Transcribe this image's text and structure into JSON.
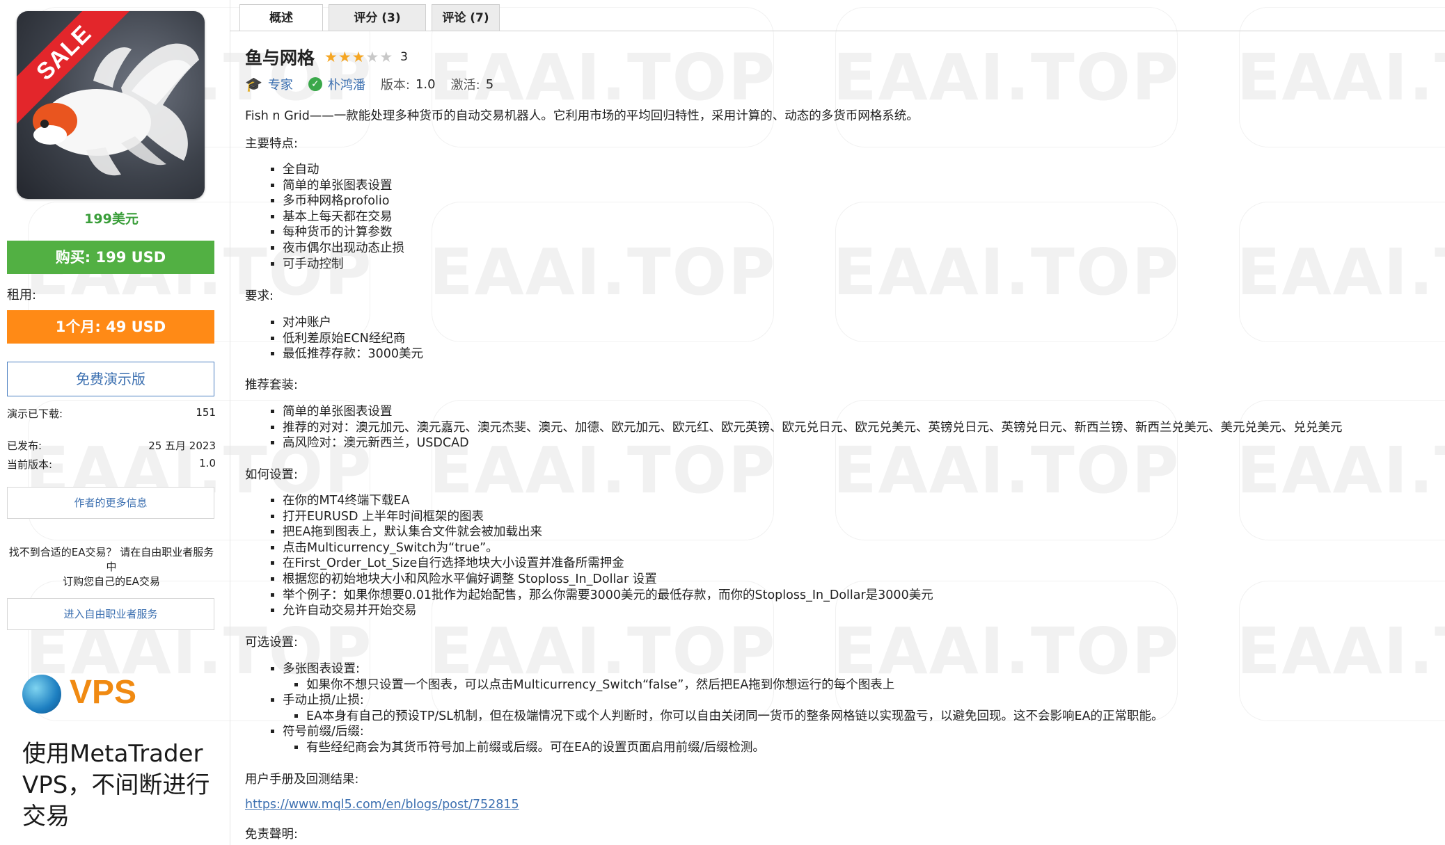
{
  "watermark": "EAAI.TOP",
  "sidebar": {
    "sale_badge": "SALE",
    "price": "199美元",
    "buy_label": "购买: 199 USD",
    "rent_label": "租用:",
    "rent_button": "1个月: 49 USD",
    "demo_button": "免费演示版",
    "demo_downloads_label": "演示已下载:",
    "demo_downloads_value": "151",
    "published_label": "已发布:",
    "published_value": "25 五月 2023",
    "version_label": "当前版本:",
    "version_value": "1.0",
    "author_more_button": "作者的更多信息",
    "find_text_1": "找不到合适的EA交易？ 请在自由职业者服务中",
    "find_text_2": "订购您自己的EA交易",
    "freelance_button": "进入自由职业者服务",
    "vps_title": "VPS",
    "vps_desc": "使用MetaTrader VPS，不间断进行交易"
  },
  "tabs": [
    {
      "label": "概述",
      "active": true
    },
    {
      "label": "评分 (3)",
      "active": false
    },
    {
      "label": "评论 (7)",
      "active": false
    }
  ],
  "product": {
    "title": "鱼与网格",
    "rating": 3,
    "rating_count": "3",
    "type_label": "专家",
    "author": "朴鸿潘",
    "version_label": "版本:",
    "version_value": "1.0",
    "activations_label": "激活:",
    "activations_value": "5"
  },
  "content": {
    "intro": "Fish n Grid——一款能处理多种货币的自动交易机器人。它利用市场的平均回归特性，采用计算的、动态的多货币网格系统。",
    "features_heading": "主要特点:",
    "features": [
      "全自动",
      "简单的单张图表设置",
      "多币种网格profolio",
      "基本上每天都在交易",
      "每种货币的计算参数",
      "夜市偶尔出现动态止损",
      "可手动控制"
    ],
    "requirements_heading": "要求:",
    "requirements": [
      "对冲账户",
      "低利差原始ECN经纪商",
      "最低推荐存款：3000美元"
    ],
    "recommended_heading": "推荐套装:",
    "recommended": [
      "简单的单张图表设置",
      "推荐的对对：澳元加元、澳元嘉元、澳元杰斐、澳元、加德、欧元加元、欧元红、欧元英镑、欧元兑日元、欧元兑美元、英镑兑日元、英镑兑日元、新西兰镑、新西兰兑美元、美元兑美元、兑兑美元",
      "高风险对：澳元新西兰，USDCAD"
    ],
    "setup_heading": "如何设置:",
    "setup": [
      "在你的MT4终端下载EA",
      "打开EURUSD 上半年时间框架的图表",
      "把EA拖到图表上，默认集合文件就会被加载出来",
      "点击Multicurrency_Switch为“true”。",
      "在First_Order_Lot_Size自行选择地块大小设置并准备所需押金",
      "根据您的初始地块大小和风险水平偏好调整 Stoploss_In_Dollar 设置",
      "举个例子：如果你想要0.01批作为起始配售，那么你需要3000美元的最低存款，而你的Stoploss_In_Dollar是3000美元",
      "允许自动交易并开始交易"
    ],
    "optional_heading": "可选设置:",
    "optional": [
      {
        "label": "多张图表设置:",
        "sub": "如果你不想只设置一个图表，可以点击Multicurrency_Switch“false”，然后把EA拖到你想运行的每个图表上"
      },
      {
        "label": "手动止损/止损:",
        "sub": "EA本身有自己的预设TP/SL机制，但在极端情况下或个人判断时，你可以自由关闭同一货币的整条网格链以实现盈亏，以避免回现。这不会影响EA的正常职能。"
      },
      {
        "label": "符号前缀/后缀:",
        "sub": "有些经纪商会为其货币符号加上前缀或后缀。可在EA的设置页面启用前缀/后缀检测。"
      }
    ],
    "manual_heading": "用户手册及回测结果:",
    "manual_link": "https://www.mql5.com/en/blogs/post/752815",
    "disclaimer_heading": "免责聲明:"
  }
}
